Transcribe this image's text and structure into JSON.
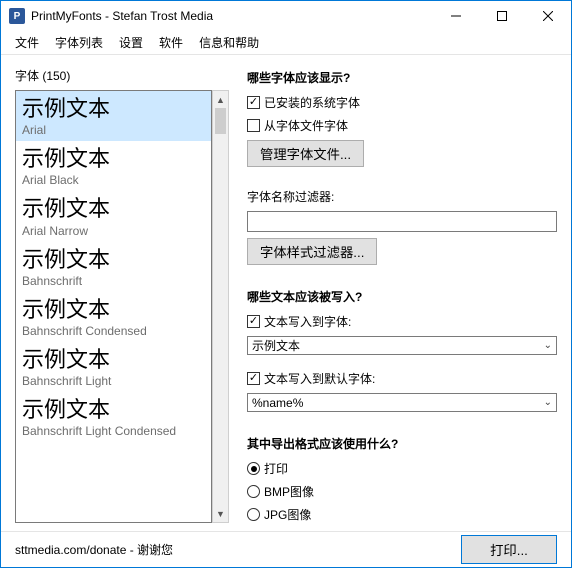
{
  "titlebar": {
    "title": "PrintMyFonts - Stefan Trost Media",
    "icon_label": "P"
  },
  "menu": {
    "items": [
      "文件",
      "字体列表",
      "设置",
      "软件",
      "信息和帮助"
    ]
  },
  "left": {
    "title": "字体 (150)",
    "items": [
      {
        "sample": "示例文本",
        "name": "Arial",
        "selected": true
      },
      {
        "sample": "示例文本",
        "name": "Arial Black"
      },
      {
        "sample": "示例文本",
        "name": "Arial Narrow"
      },
      {
        "sample": "示例文本",
        "name": "Bahnschrift"
      },
      {
        "sample": "示例文本",
        "name": "Bahnschrift Condensed"
      },
      {
        "sample": "示例文本",
        "name": "Bahnschrift Light"
      },
      {
        "sample": "示例文本",
        "name": "Bahnschrift Light Condensed"
      }
    ]
  },
  "right": {
    "section1_title": "哪些字体应该显示?",
    "cb_installed": {
      "label": "已安装的系统字体",
      "checked": true
    },
    "cb_fromfile": {
      "label": "从字体文件字体",
      "checked": false
    },
    "btn_manage": "管理字体文件...",
    "filter_label": "字体名称过滤器:",
    "filter_value": "",
    "btn_style_filter": "字体样式过滤器...",
    "section2_title": "哪些文本应该被写入?",
    "cb_text_in_font": {
      "label": "文本写入到字体:",
      "checked": true
    },
    "select_text_in_font": "示例文本",
    "cb_text_default": {
      "label": "文本写入到默认字体:",
      "checked": true
    },
    "select_text_default": "%name%",
    "section3_title": "其中导出格式应该使用什么?",
    "radios": {
      "print": "打印",
      "bmp": "BMP图像",
      "jpg": "JPG图像",
      "selected": "print"
    }
  },
  "footer": {
    "status": "sttmedia.com/donate - 谢谢您",
    "print_btn": "打印..."
  }
}
